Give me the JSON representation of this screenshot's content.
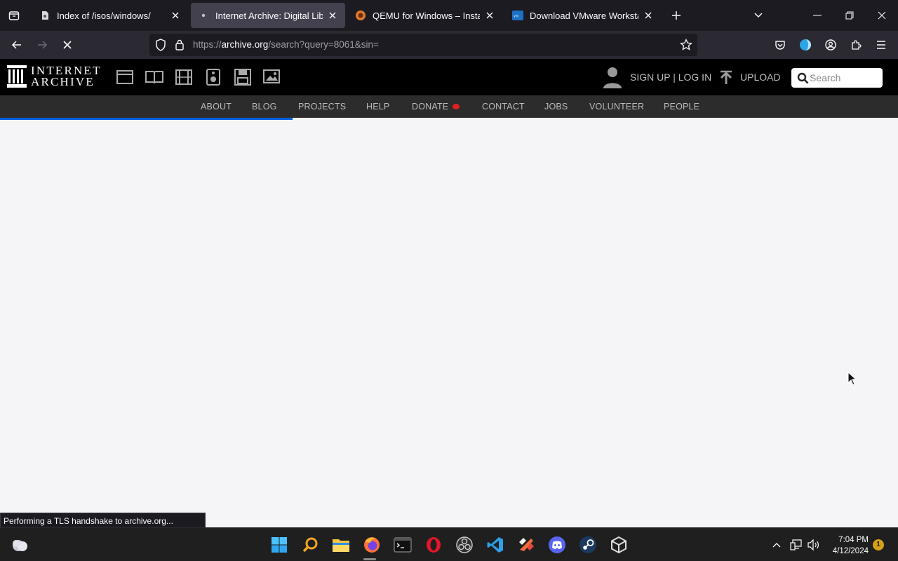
{
  "browser": {
    "tabs": [
      {
        "title": "Index of /isos/windows/",
        "favicon": "page-tools-icon",
        "active": false
      },
      {
        "title": "Internet Archive: Digital Library",
        "favicon": "loading-dot-icon",
        "active": true
      },
      {
        "title": "QEMU for Windows – Installers",
        "favicon": "qemu-icon",
        "active": false
      },
      {
        "title": "Download VMware Workstation",
        "favicon": "vmware-icon",
        "active": false
      }
    ],
    "url_prefix": "https://",
    "url_host": "archive.org",
    "url_path": "/search?query=8061&sin=",
    "status_text": "Performing a TLS handshake to archive.org...",
    "page_load_progress": 0.326
  },
  "ia": {
    "logo_line1": "INTERNET",
    "logo_line2": "ARCHIVE",
    "media_icons": [
      "web-icon",
      "texts-icon",
      "video-icon",
      "audio-icon",
      "software-icon",
      "images-icon"
    ],
    "signup_login": "SIGN UP | LOG IN",
    "upload": "UPLOAD",
    "search_placeholder": "Search",
    "nav": [
      "ABOUT",
      "BLOG",
      "PROJECTS",
      "HELP",
      "DONATE",
      "CONTACT",
      "JOBS",
      "VOLUNTEER",
      "PEOPLE"
    ]
  },
  "taskbar": {
    "time": "7:04 PM",
    "date": "4/12/2024",
    "notifications": "1",
    "apps": [
      "weather-icon",
      "start-icon",
      "search-icon",
      "file-explorer-icon",
      "firefox-icon",
      "terminal-icon",
      "opera-icon",
      "obs-icon",
      "vscode-icon",
      "app-icon",
      "discord-icon",
      "steam-icon",
      "virtualbox-icon"
    ]
  },
  "colors": {
    "tab_bg": "#1c1b22",
    "active_tab": "#42414d",
    "ia_header": "#000000",
    "ia_nav": "#2c2c2c",
    "progress": "#0060df"
  }
}
